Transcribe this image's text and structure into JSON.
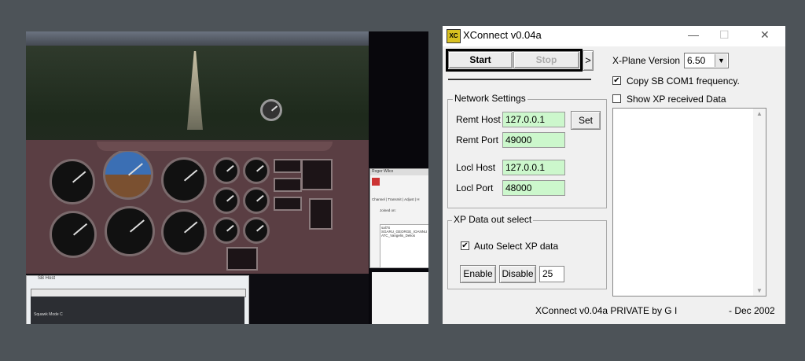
{
  "xconnect": {
    "title": "XConnect v0.04a",
    "window_controls": {
      "minimize": "—",
      "maximize": "☐",
      "close": "✕"
    },
    "start_label": "Start",
    "stop_label": "Stop",
    "arrow_label": ">",
    "xplane_version_label": "X-Plane Version",
    "xplane_version_value": "6.50",
    "copy_sb_label": "Copy SB COM1 frequency.",
    "copy_sb_checked": "✔",
    "show_xp_label": "Show XP received  Data",
    "network": {
      "group_label": "Network Settings",
      "remt_host_label": "Remt Host",
      "remt_host_value": "127.0.0.1",
      "set_label": "Set",
      "remt_port_label": "Remt Port",
      "remt_port_value": "49000",
      "locl_host_label": "Locl Host",
      "locl_host_value": "127.0.0.1",
      "locl_port_label": "Locl Port",
      "locl_port_value": "48000"
    },
    "xp_data": {
      "group_label": "XP Data out select",
      "auto_select_label": "Auto Select XP data",
      "auto_select_checked": "✔",
      "enable_label": "Enable",
      "disable_label": "Disable",
      "count_value": "25"
    },
    "footer_left": "XConnect v0.04a PRIVATE  by G I",
    "footer_right": "- Dec 2002"
  },
  "sim": {
    "roger_wilco_title": "Roger Wilco",
    "roger_wilco_tabs": "Channel | Transmit | Adjust | H",
    "roger_wilco_list": [
      "sal7S",
      "SGARU_GEORGE_IOANNU",
      "ATC_Vangelis_Delios"
    ],
    "roger_wilco_joined": "Joined on:",
    "sb_window_title": "SB Host",
    "sb_console_line": "Squawk Mode C"
  }
}
